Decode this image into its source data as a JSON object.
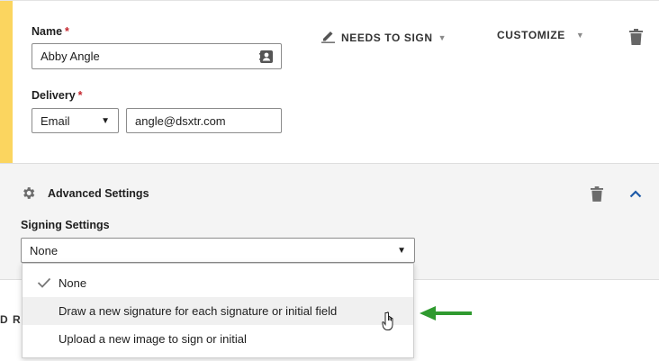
{
  "recipient": {
    "name_label": "Name",
    "name_value": "Abby Angle",
    "delivery_label": "Delivery",
    "delivery_method": "Email",
    "email_value": "angle@dsxtr.com",
    "required_mark": "*"
  },
  "toolbar": {
    "needs_to_sign_label": "NEEDS TO SIGN",
    "customize_label": "CUSTOMIZE"
  },
  "advanced": {
    "title": "Advanced Settings",
    "signing_settings_label": "Signing Settings",
    "selected_value": "None"
  },
  "dropdown": {
    "options": [
      {
        "label": "None",
        "selected": true
      },
      {
        "label": "Draw a new signature for each signature or initial field",
        "hovered": true
      },
      {
        "label": "Upload a new image to sign or initial"
      }
    ]
  },
  "partial_text": "D R",
  "colors": {
    "accent_yellow": "#fbd55f",
    "required_red": "#c4262e",
    "chevron_blue": "#1e5aa8",
    "arrow_green": "#2f9a2f"
  },
  "icons": {
    "contacts": "contact-card-icon",
    "pen": "pen-icon",
    "trash": "trash-icon",
    "gear": "gear-icon",
    "chevron_up": "chevron-up-icon",
    "check": "check-icon",
    "cursor": "hand-cursor-icon",
    "arrow": "green-arrow-icon"
  }
}
